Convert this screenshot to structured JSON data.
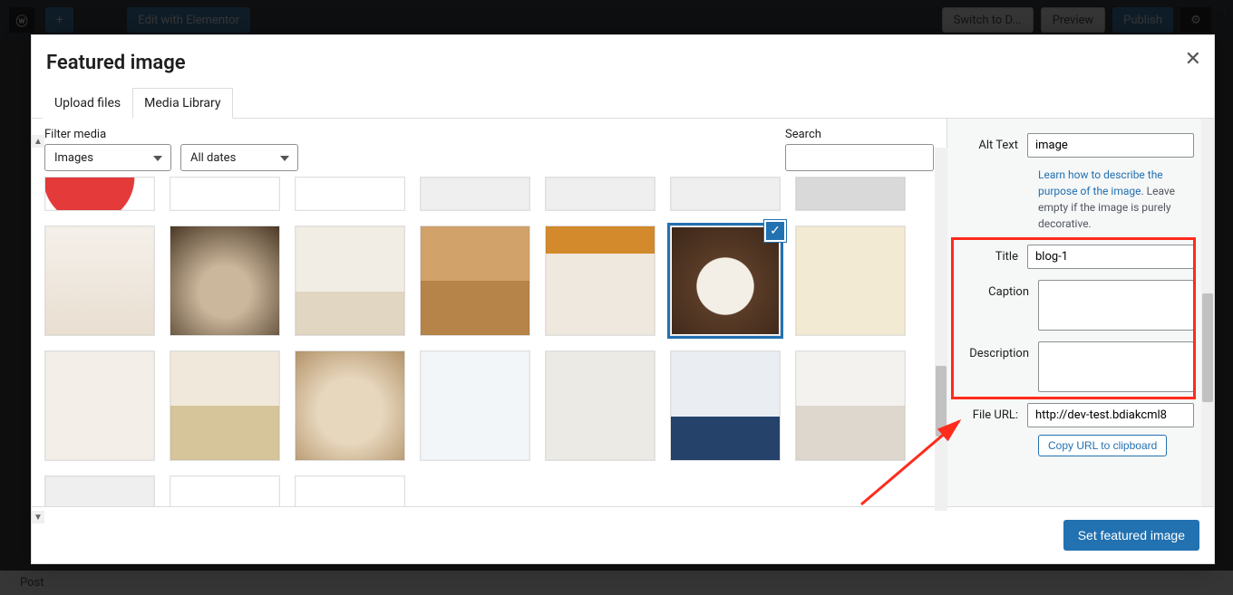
{
  "admin": {
    "edit_elementor": "Edit with Elementor",
    "footer": "Post",
    "top_right": {
      "switch": "Switch to D...",
      "preview": "Preview",
      "publish": "Publish"
    }
  },
  "modal": {
    "title": "Featured image",
    "tabs": {
      "upload": "Upload files",
      "library": "Media Library"
    },
    "filter_label": "Filter media",
    "filter_images": "Images",
    "filter_dates": "All dates",
    "search_label": "Search",
    "set_btn": "Set featured image"
  },
  "details": {
    "alt_label": "Alt Text",
    "alt_value": "image",
    "help_link": "Learn how to describe the purpose of the image.",
    "help_rest": " Leave empty if the image is purely decorative.",
    "title_label": "Title",
    "title_value": "blog-1",
    "caption_label": "Caption",
    "caption_value": "",
    "desc_label": "Description",
    "desc_value": "",
    "fileurl_label": "File URL:",
    "fileurl_value": "http://dev-test.bdiakcml8",
    "copy_btn": "Copy URL to clipboard"
  }
}
